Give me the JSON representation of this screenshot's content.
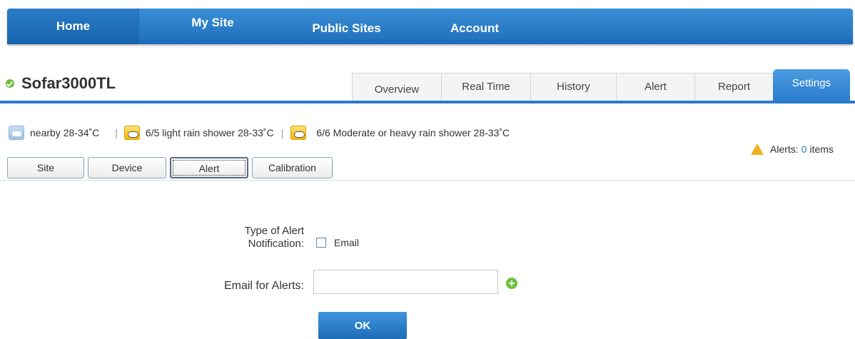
{
  "nav": {
    "home": "Home",
    "my_site": "My Site",
    "public_sites": "Public Sites",
    "account": "Account"
  },
  "site": {
    "name": "Sofar3000TL",
    "status_icon": "status-ok-icon"
  },
  "tabs": {
    "overview": "Overview",
    "real_time": "Real Time",
    "history": "History",
    "alert": "Alert",
    "report": "Report",
    "settings": "Settings",
    "active": "Settings"
  },
  "weather": {
    "nearby": "nearby 28-34˚C",
    "day1": "6/5 light rain shower 28-33˚C",
    "day2": "6/6 Moderate or heavy rain shower 28-33˚C",
    "separator": "|"
  },
  "alerts": {
    "label": "Alerts:",
    "count": "0",
    "suffix": "items"
  },
  "subtabs": {
    "site": "Site",
    "device": "Device",
    "alert": "Alert",
    "calibration": "Calibration",
    "active": "Alert"
  },
  "form": {
    "type_label_line1": "Type of Alert",
    "type_label_line2": "Notification:",
    "email_option": "Email",
    "email_checked": false,
    "email_for_alerts_label": "Email for Alerts:",
    "email_value": "",
    "ok_button": "OK"
  },
  "colors": {
    "brand_blue": "#2b7ccc",
    "status_green": "#6cbf3c",
    "warning_amber": "#f2b01e"
  }
}
